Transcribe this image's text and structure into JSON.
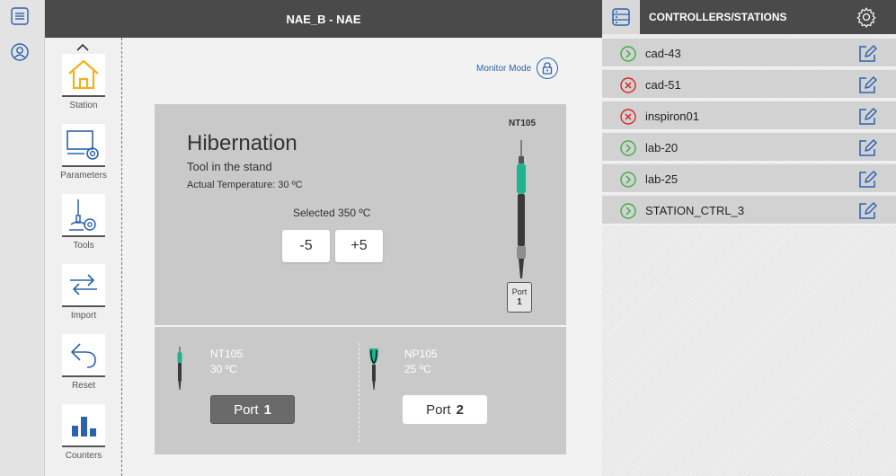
{
  "header": {
    "title": "NAE_B - NAE"
  },
  "rail": {
    "icons": [
      "menu-icon",
      "user-icon"
    ]
  },
  "nav": {
    "items": [
      {
        "label": "Station",
        "icon": "home-icon"
      },
      {
        "label": "Parameters",
        "icon": "parameters-icon"
      },
      {
        "label": "Tools",
        "icon": "tools-icon"
      },
      {
        "label": "Import",
        "icon": "import-arrows-icon"
      },
      {
        "label": "Reset",
        "icon": "reset-icon"
      },
      {
        "label": "Counters",
        "icon": "counters-chart-icon"
      }
    ]
  },
  "station": {
    "monitor_label": "Monitor Mode",
    "status_title": "Hibernation",
    "status_sub": "Tool in the stand",
    "actual_temp": "Actual Temperature: 30 ºC",
    "selected_temp": "Selected 350 ºC",
    "minus_label": "-5",
    "plus_label": "+5",
    "tool_model": "NT105",
    "port_badge_label": "Port",
    "port_badge_num": "1"
  },
  "ports": [
    {
      "tool": "NT105",
      "temp": "30 ºC",
      "label": "Port",
      "num": "1",
      "active": true
    },
    {
      "tool": "NP105",
      "temp": "25 ºC",
      "label": "Port",
      "num": "2",
      "active": false
    }
  ],
  "controllers": {
    "title": "CONTROLLERS/STATIONS",
    "items": [
      {
        "name": "cad-43",
        "status": "ok"
      },
      {
        "name": "cad-51",
        "status": "error"
      },
      {
        "name": "inspiron01",
        "status": "error"
      },
      {
        "name": "lab-20",
        "status": "ok"
      },
      {
        "name": "lab-25",
        "status": "ok"
      },
      {
        "name": "STATION_CTRL_3",
        "status": "ok"
      }
    ]
  },
  "colors": {
    "accent_blue": "#2b62b0",
    "status_ok": "#3cb043",
    "status_error": "#d62828",
    "home_yellow": "#f2b01e",
    "tool_teal": "#1fb38e",
    "header_dark": "#4a4a4a"
  }
}
